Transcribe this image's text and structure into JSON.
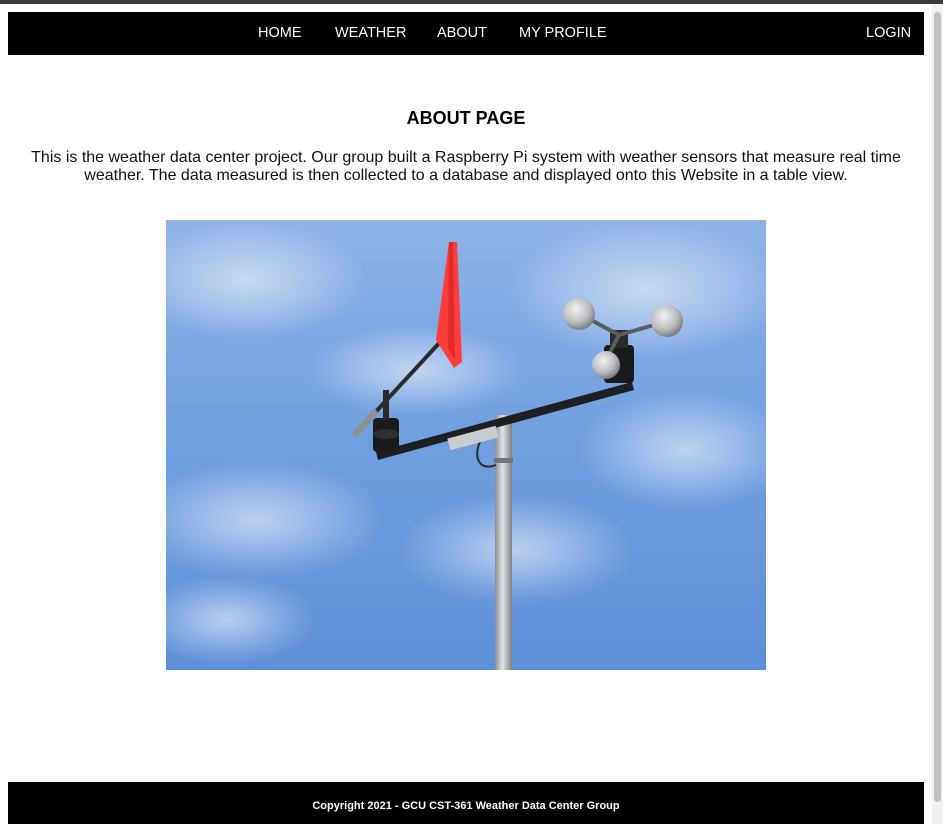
{
  "nav": {
    "home": "HOME",
    "weather": "WEATHER",
    "about": "ABOUT",
    "profile": "MY PROFILE",
    "login": "LOGIN"
  },
  "main": {
    "title": "ABOUT PAGE",
    "description": "This is the weather data center project. Our group built a Raspberry Pi system with weather sensors that measure real time weather. The data measured is then collected to a database and displayed onto this Website in a table view."
  },
  "footer": {
    "copyright": "Copyright 2021 - GCU CST-361 Weather Data Center Group"
  },
  "colors": {
    "nav_bg": "#000000",
    "nav_text": "#ffffff",
    "sky": "#6f9fe0",
    "flag": "#ff3b3b"
  }
}
